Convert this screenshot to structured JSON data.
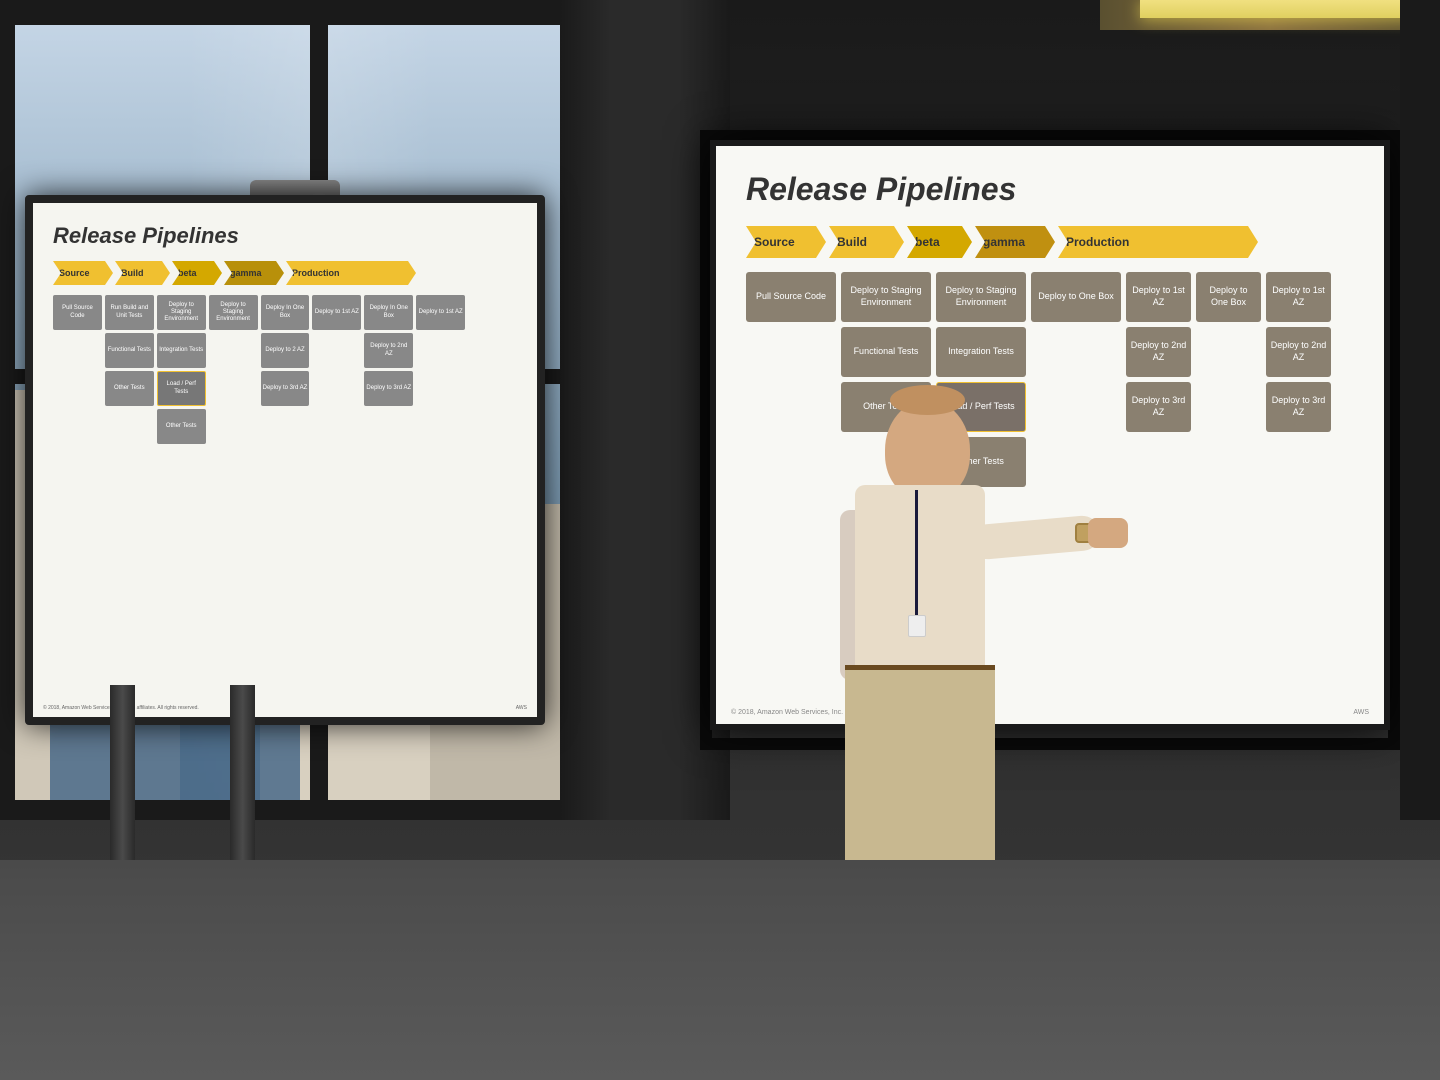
{
  "scene": {
    "title": "Conference Room Presentation - Release Pipelines"
  },
  "slide_left": {
    "title": "Release Pipelines",
    "stages": [
      "Source",
      "Build",
      "beta",
      "gamma",
      "Production"
    ],
    "boxes": [
      "Pull Source Code",
      "Run Build and Unit Tests",
      "Deploy to Staging Environment",
      "Deploy to Staging Environment",
      "Deploy In One Box",
      "Deploy to 1st AZ",
      "Deploy In One Box",
      "Deploy to 1st AZ",
      "Functional Tests",
      "Integration Tests",
      "Deploy to 2 AZ",
      "Deploy to 2nd AZ",
      "Other Tests",
      "Load / Perf Tests",
      "Deploy to 3rd AZ",
      "Deploy to 3rd AZ",
      "Other Tests"
    ],
    "footer_left": "© 2018, Amazon Web Services, Inc. or its affiliates. All rights reserved.",
    "footer_right": "AWS"
  },
  "slide_right": {
    "title": "Release Pipelines",
    "stages": [
      "Source",
      "Build",
      "beta",
      "gamma",
      "Production"
    ],
    "boxes": [
      "Pull Source Code",
      "Deploy to Staging Environment",
      "Deploy to Staging Environment",
      "Deploy to One Box",
      "Deploy to 1st AZ",
      "Deploy to One Box",
      "Deploy to 1st AZ",
      "Functional Tests",
      "Integration Tests",
      "Deploy to 2nd AZ",
      "Deploy to 2nd AZ",
      "Other Tests",
      "Load / Perf Tests",
      "Deploy to 3rd AZ",
      "Deploy to 3rd AZ",
      "Other Tests",
      "Other Tests"
    ],
    "footer_left": "© 2018, Amazon Web Services, Inc. or its affiliates. All rights reserved.",
    "footer_right": "AWS"
  },
  "highlighted_box": "Load  Perf"
}
